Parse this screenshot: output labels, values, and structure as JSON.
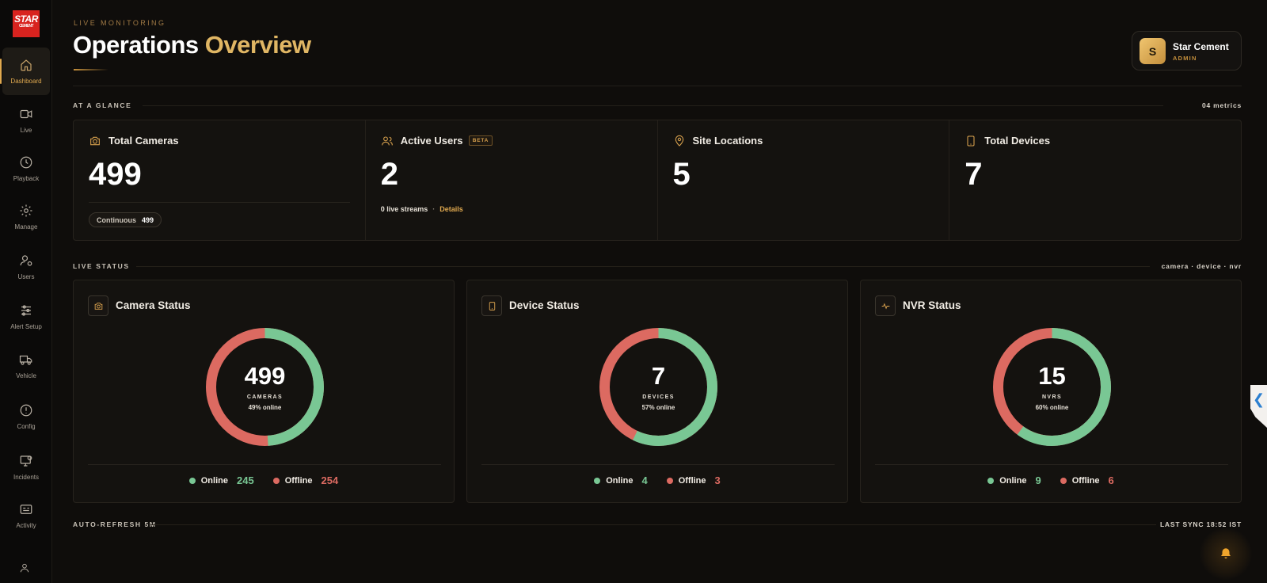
{
  "brand": {
    "logo_text": "STAR",
    "logo_sub": "CEMENT"
  },
  "sidebar": {
    "items": [
      {
        "label": "Dashboard",
        "icon": "home-icon"
      },
      {
        "label": "Live",
        "icon": "video-icon"
      },
      {
        "label": "Playback",
        "icon": "clock-icon"
      },
      {
        "label": "Manage",
        "icon": "gear-icon"
      },
      {
        "label": "Users",
        "icon": "user-settings-icon"
      },
      {
        "label": "Alert Setup",
        "icon": "sliders-icon"
      },
      {
        "label": "Vehicle",
        "icon": "truck-icon"
      },
      {
        "label": "Config",
        "icon": "alert-circle-icon"
      },
      {
        "label": "Incidents",
        "icon": "monitor-alert-icon"
      },
      {
        "label": "Activity",
        "icon": "activity-log-icon"
      }
    ],
    "active": "Dashboard"
  },
  "header": {
    "eyebrow": "LIVE MONITORING",
    "title_main": "Operations",
    "title_accent": "Overview"
  },
  "user": {
    "initial": "S",
    "name": "Star Cement",
    "role": "ADMIN"
  },
  "glance": {
    "label": "AT A GLANCE",
    "meta": "04 metrics",
    "metrics": [
      {
        "label": "Total Cameras",
        "value": "499",
        "pill_label": "Continuous",
        "pill_count": "499"
      },
      {
        "label": "Active Users",
        "badge": "BETA",
        "value": "2",
        "streams": "0 live streams",
        "separator": "·",
        "details": "Details"
      },
      {
        "label": "Site Locations",
        "value": "5"
      },
      {
        "label": "Total Devices",
        "value": "7"
      }
    ]
  },
  "live_status": {
    "label": "LIVE STATUS",
    "meta": "camera · device · nvr",
    "cards": [
      {
        "title": "Camera Status",
        "total": "499",
        "unit": "CAMERAS",
        "pct": "49% online",
        "online_label": "Online",
        "online": 245,
        "offline_label": "Offline",
        "offline": 254
      },
      {
        "title": "Device Status",
        "total": "7",
        "unit": "DEVICES",
        "pct": "57% online",
        "online_label": "Online",
        "online": 4,
        "offline_label": "Offline",
        "offline": 3
      },
      {
        "title": "NVR Status",
        "total": "15",
        "unit": "NVRS",
        "pct": "60% online",
        "online_label": "Online",
        "online": 9,
        "offline_label": "Offline",
        "offline": 6
      }
    ]
  },
  "footer": {
    "left": "AUTO-REFRESH 5M",
    "right": "LAST SYNC 18:52 IST"
  },
  "side_tab": {
    "glyph": "❮"
  },
  "colors": {
    "accent": "#e0b664",
    "online": "#79c794",
    "offline": "#dc6a61",
    "background": "#0f0d0b"
  }
}
